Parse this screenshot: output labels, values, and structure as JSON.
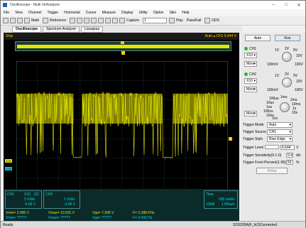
{
  "window": {
    "title": "Oscilloscope - Multi VirAnalyzer"
  },
  "menu": [
    "File",
    "View",
    "Channel",
    "Trigger",
    "Horizontal",
    "Cursor",
    "Measure",
    "Display",
    "Utility",
    "Option",
    "Skin",
    "Help"
  ],
  "toolbar": {
    "math_label": "Math",
    "reference_label": "Reference",
    "capture_label": "Capture",
    "capture_value": "1",
    "play_label": "Play",
    "pass_fail_label": "Pass/Fail",
    "dds_label": "DDS"
  },
  "tabs": [
    "Oscilloscope",
    "Spectrum Analyzer",
    "Lissajous"
  ],
  "scope": {
    "state": "Stop",
    "trigger_status": "Auto",
    "trigger_level_readout": "CH1 6.644 V",
    "waveform_color": "#e5e500",
    "grid_color": "#3c6e6e",
    "ch1_marker": "CH1",
    "ch2_marker": "CH2"
  },
  "info": {
    "ch1": {
      "name": "CH1",
      "probe": "X10",
      "coupling": "DC",
      "vdiv": "3 V/div",
      "offset": "-6.09 V"
    },
    "ch2": {
      "name": "CH2",
      "vdiv": "1 V/div",
      "offset": "-3.95 V"
    },
    "time": {
      "label": "Time",
      "tdiv": "200 us/div",
      "depth": "12KB",
      "rate": "1 MSa/s"
    },
    "measurements": [
      {
        "a": "Vmin= 2.995 V",
        "b": "Vmax= 10.931 V",
        "c": "Vpp= 7.936 V",
        "d": "F= 2.388 KHz"
      },
      {
        "a": "Vmin= ?????",
        "b": "Vmax= ?????",
        "c": "Vpp= ?????",
        "d": "F= 0.000 Hz"
      }
    ]
  },
  "side": {
    "auto_label": "Auto",
    "run_label": "Run",
    "ch1_label": "CH1",
    "ch1_probe": "X10",
    "ch1_mode": "More",
    "ch1_scale_labels": [
      "1V",
      "2V",
      "5V",
      "10V",
      "100mV",
      "100V"
    ],
    "ch2_label": "CH2",
    "ch2_probe": "X10",
    "ch2_mode": "More",
    "ch2_scale_labels": [
      "1V",
      "2V",
      "5V",
      "10V",
      "100mV",
      "100V"
    ],
    "time_scale_labels": [
      "1ms",
      "2ms",
      "10ms",
      "1s",
      "10s",
      "100us",
      "10us",
      "1us",
      "100ns",
      "10ns",
      "1ns"
    ],
    "time_mode": "More",
    "trigger_mode_label": "Trigger Mode",
    "trigger_mode_value": "Auto",
    "trigger_source_label": "Trigger Source",
    "trigger_source_value": "CH1",
    "trigger_style_label": "Trigger Style",
    "trigger_style_value": "Rise Edge",
    "trigger_level_label": "Trigger Level",
    "trigger_level_value": "6.644",
    "trigger_level_unit": "V",
    "sensitivity_label": "Trigger Sensitivity(0-1.0)",
    "sensitivity_value": "0.4",
    "sensitivity_unit": "div",
    "front_percent_label": "Trigger Front Percent(1-99)",
    "front_percent_value": "50",
    "front_percent_unit": "%",
    "force_label": "Force"
  },
  "status": {
    "left": "Ready",
    "right": "SDS205A(F_fx2)Connected"
  }
}
